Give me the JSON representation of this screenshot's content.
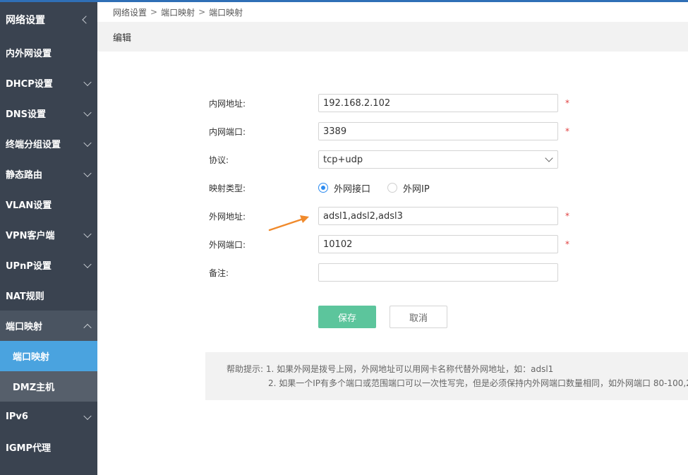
{
  "sidebar": {
    "header": "网络设置",
    "items": [
      {
        "label": "内外网设置"
      },
      {
        "label": "DHCP设置"
      },
      {
        "label": "DNS设置"
      },
      {
        "label": "终端分组设置"
      },
      {
        "label": "静态路由"
      },
      {
        "label": "VLAN设置"
      },
      {
        "label": "VPN客户端"
      },
      {
        "label": "UPnP设置"
      },
      {
        "label": "NAT规则"
      },
      {
        "label": "端口映射"
      },
      {
        "label": "端口映射"
      },
      {
        "label": "DMZ主机"
      },
      {
        "label": "IPv6"
      },
      {
        "label": "IGMP代理"
      }
    ]
  },
  "breadcrumb": [
    "网络设置",
    "端口映射",
    "端口映射"
  ],
  "breadcrumb_sep": ">",
  "panel_title": "编辑",
  "form": {
    "lan_ip": {
      "label": "内网地址:",
      "value": "192.168.2.102"
    },
    "lan_port": {
      "label": "内网端口:",
      "value": "3389"
    },
    "protocol": {
      "label": "协议:",
      "value": "tcp+udp"
    },
    "map_type": {
      "label": "映射类型:",
      "option1": "外网接口",
      "option2": "外网IP"
    },
    "wan_addr": {
      "label": "外网地址:",
      "value": "adsl1,adsl2,adsl3"
    },
    "wan_port": {
      "label": "外网端口:",
      "value": "10102"
    },
    "remark": {
      "label": "备注:",
      "value": ""
    },
    "required_mark": "*"
  },
  "buttons": {
    "save": "保存",
    "cancel": "取消"
  },
  "help": {
    "line1": "帮助提示: 1. 如果外网是拨号上网，外网地址可以用网卡名称代替外网地址，如：adsl1",
    "line2": "2. 如果一个IP有多个端口或范围端口可以一次性写完，但是必须保持内外网端口数量相同，如外网端口 80-100,2"
  },
  "colors": {
    "sidebar_bg": "#3a4350",
    "active": "#4aa3df",
    "save_btn": "#5cc59c",
    "arrow": "#f08a2c"
  }
}
